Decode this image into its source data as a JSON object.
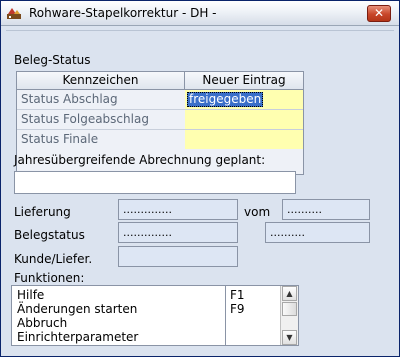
{
  "window": {
    "title": "Rohware-Stapelkorrektur - DH -",
    "close_label": "✕"
  },
  "beleg_status": {
    "heading": "Beleg-Status",
    "col_kennzeichen": "Kennzeichen",
    "col_neuer_eintrag": "Neuer Eintrag",
    "rows": [
      {
        "label": "Status Abschlag",
        "value": "freigegeben"
      },
      {
        "label": "Status Folgeabschlag",
        "value": ""
      },
      {
        "label": "Status Finale",
        "value": ""
      }
    ]
  },
  "jahres": {
    "label": "Jahresübergreifende Abrechnung geplant:",
    "value": ""
  },
  "lieferung": {
    "label": "Lieferung",
    "value": "..............",
    "vom_label": "vom",
    "vom_value": ".........."
  },
  "belegstatus": {
    "label": "Belegstatus",
    "value": "..............",
    "value2": ".........."
  },
  "kunde": {
    "label": "Kunde/Liefer.",
    "value": ""
  },
  "funktionen": {
    "label": "Funktionen:",
    "items": [
      {
        "name": "Hilfe",
        "key": "F1"
      },
      {
        "name": "Änderungen starten",
        "key": "F9"
      },
      {
        "name": "Abbruch",
        "key": ""
      },
      {
        "name": "Einrichterparameter",
        "key": ""
      }
    ]
  },
  "colors": {
    "title_bg": "#eef2f7",
    "content_bg": "#dbe3ef",
    "highlight_cell": "#ffffb0",
    "selection": "#3a6fc9",
    "close_button": "#c8462a"
  },
  "icons": {
    "app": "app-icon",
    "close": "close-icon"
  }
}
